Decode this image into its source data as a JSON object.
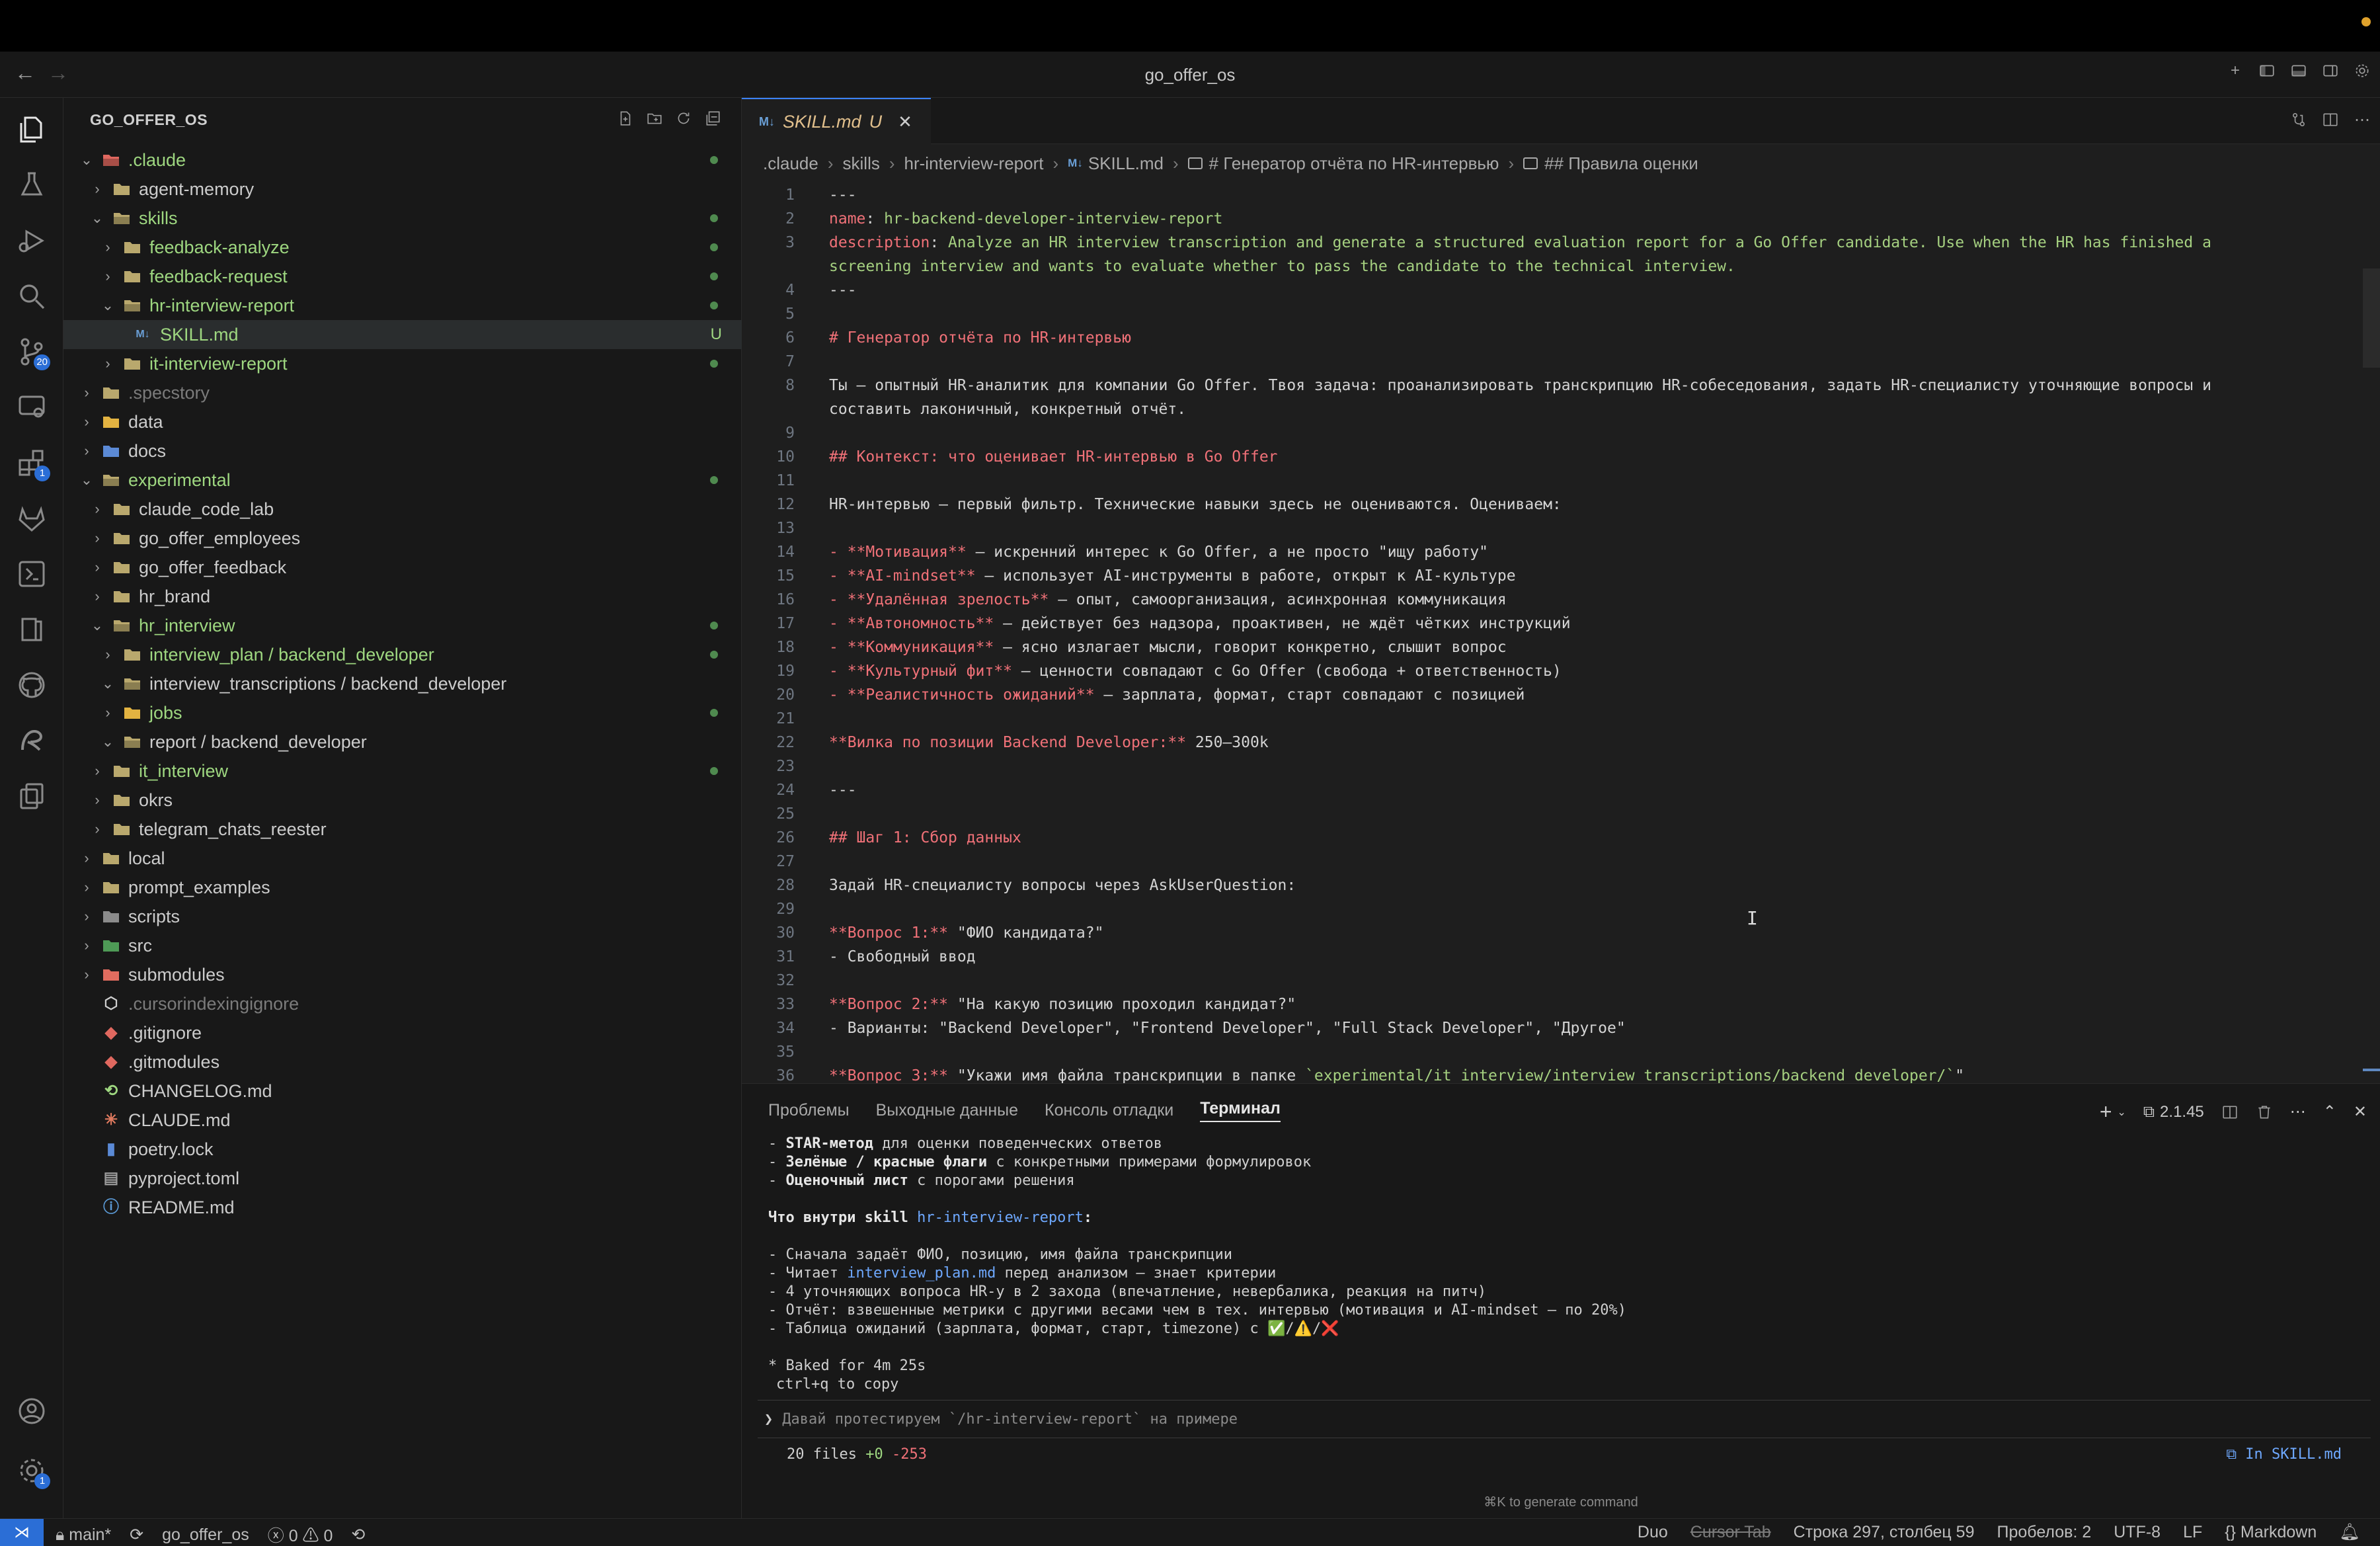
{
  "window": {
    "title": "go_offer_os",
    "back_glyph": "←",
    "forward_glyph": "→",
    "accent": "#2b6ed6",
    "recording_dot_color": "#e0a22c"
  },
  "activity": {
    "source_control_badge": "20",
    "extensions_badge": "1",
    "settings_badge": "1"
  },
  "explorer": {
    "title": "GO_OFFER_OS",
    "items": [
      {
        "label": ".claude",
        "depth": 0,
        "kind": "folder-open",
        "color": "#f07178",
        "icon": "folder-claude-icon",
        "git": "dot",
        "text": "green"
      },
      {
        "label": "agent-memory",
        "depth": 1,
        "kind": "folder",
        "icon": "folder-icon"
      },
      {
        "label": "skills",
        "depth": 1,
        "kind": "folder-open",
        "icon": "folder-icon",
        "git": "dot",
        "text": "green"
      },
      {
        "label": "feedback-analyze",
        "depth": 2,
        "kind": "folder",
        "icon": "folder-icon",
        "git": "dot",
        "text": "green"
      },
      {
        "label": "feedback-request",
        "depth": 2,
        "kind": "folder",
        "icon": "folder-icon",
        "git": "dot",
        "text": "green"
      },
      {
        "label": "hr-interview-report",
        "depth": 2,
        "kind": "folder-open",
        "icon": "folder-icon",
        "git": "dot",
        "text": "green"
      },
      {
        "label": "SKILL.md",
        "depth": 3,
        "kind": "file-md",
        "icon": "markdown-icon",
        "git": "U",
        "text": "green",
        "selected": true
      },
      {
        "label": "it-interview-report",
        "depth": 2,
        "kind": "folder",
        "icon": "folder-icon",
        "git": "dot",
        "text": "green"
      },
      {
        "label": ".specstory",
        "depth": 0,
        "kind": "folder",
        "icon": "folder-icon",
        "text": "dim"
      },
      {
        "label": "data",
        "depth": 0,
        "kind": "folder",
        "icon": "folder-data-icon"
      },
      {
        "label": "docs",
        "depth": 0,
        "kind": "folder",
        "icon": "folder-docs-icon"
      },
      {
        "label": "experimental",
        "depth": 0,
        "kind": "folder-open",
        "icon": "folder-icon",
        "git": "dot",
        "text": "green"
      },
      {
        "label": "claude_code_lab",
        "depth": 1,
        "kind": "folder",
        "icon": "folder-icon"
      },
      {
        "label": "go_offer_employees",
        "depth": 1,
        "kind": "folder",
        "icon": "folder-icon"
      },
      {
        "label": "go_offer_feedback",
        "depth": 1,
        "kind": "folder",
        "icon": "folder-icon"
      },
      {
        "label": "hr_brand",
        "depth": 1,
        "kind": "folder",
        "icon": "folder-icon"
      },
      {
        "label": "hr_interview",
        "depth": 1,
        "kind": "folder-open",
        "icon": "folder-icon",
        "git": "dot",
        "text": "green"
      },
      {
        "label": "interview_plan / backend_developer",
        "depth": 2,
        "kind": "folder",
        "icon": "folder-icon",
        "git": "dot",
        "text": "green"
      },
      {
        "label": "interview_transcriptions / backend_developer",
        "depth": 2,
        "kind": "folder-open",
        "icon": "folder-icon"
      },
      {
        "label": "jobs",
        "depth": 2,
        "kind": "folder",
        "icon": "folder-jobs-icon",
        "git": "dot",
        "text": "green"
      },
      {
        "label": "report / backend_developer",
        "depth": 2,
        "kind": "folder-open",
        "icon": "folder-icon"
      },
      {
        "label": "it_interview",
        "depth": 1,
        "kind": "folder",
        "icon": "folder-icon",
        "git": "dot",
        "text": "green"
      },
      {
        "label": "okrs",
        "depth": 1,
        "kind": "folder",
        "icon": "folder-icon"
      },
      {
        "label": "telegram_chats_reester",
        "depth": 1,
        "kind": "folder",
        "icon": "folder-icon"
      },
      {
        "label": "local",
        "depth": 0,
        "kind": "folder",
        "icon": "folder-icon"
      },
      {
        "label": "prompt_examples",
        "depth": 0,
        "kind": "folder",
        "icon": "folder-icon"
      },
      {
        "label": "scripts",
        "depth": 0,
        "kind": "folder",
        "icon": "folder-scripts-icon"
      },
      {
        "label": "src",
        "depth": 0,
        "kind": "folder",
        "icon": "folder-src-icon"
      },
      {
        "label": "submodules",
        "depth": 0,
        "kind": "folder",
        "icon": "folder-submodules-icon"
      },
      {
        "label": ".cursorindexingignore",
        "depth": 0,
        "kind": "file",
        "icon": "cube-icon",
        "text": "dim"
      },
      {
        "label": ".gitignore",
        "depth": 0,
        "kind": "file",
        "icon": "git-icon"
      },
      {
        "label": ".gitmodules",
        "depth": 0,
        "kind": "file",
        "icon": "git-icon"
      },
      {
        "label": "CHANGELOG.md",
        "depth": 0,
        "kind": "file",
        "icon": "changelog-icon"
      },
      {
        "label": "CLAUDE.md",
        "depth": 0,
        "kind": "file",
        "icon": "claude-icon"
      },
      {
        "label": "poetry.lock",
        "depth": 0,
        "kind": "file",
        "icon": "poetry-icon"
      },
      {
        "label": "pyproject.toml",
        "depth": 0,
        "kind": "file",
        "icon": "toml-icon"
      },
      {
        "label": "README.md",
        "depth": 0,
        "kind": "file",
        "icon": "info-icon"
      }
    ]
  },
  "tab": {
    "md_badge": "M↓",
    "name": "SKILL.md",
    "status": "U",
    "close": "✕"
  },
  "breadcrumb": [
    ".claude",
    "skills",
    "hr-interview-report",
    "SKILL.md",
    "# Генератор отчёта по HR-интервью",
    "## Правила оценки"
  ],
  "code_lines": [
    {
      "n": "1",
      "parts": [
        [
          "",
          "---"
        ]
      ]
    },
    {
      "n": "2",
      "parts": [
        [
          "k-key",
          "name"
        ],
        [
          "",
          ": "
        ],
        [
          "k-val",
          "hr-backend-developer-interview-report"
        ]
      ]
    },
    {
      "n": "3",
      "parts": [
        [
          "k-key",
          "description"
        ],
        [
          "",
          ": "
        ],
        [
          "k-val",
          "Analyze an HR interview transcription and generate a structured evaluation report for a Go Offer candidate. Use when the HR has finished a"
        ]
      ]
    },
    {
      "n": "",
      "parts": [
        [
          "k-val",
          "screening interview and wants to evaluate whether to pass the candidate to the technical interview."
        ]
      ]
    },
    {
      "n": "4",
      "parts": [
        [
          "",
          "---"
        ]
      ]
    },
    {
      "n": "5",
      "parts": []
    },
    {
      "n": "6",
      "parts": [
        [
          "k-h",
          "# Генератор отчёта по HR-интервью"
        ]
      ]
    },
    {
      "n": "7",
      "parts": []
    },
    {
      "n": "8",
      "parts": [
        [
          "",
          "Ты — опытный HR-аналитик для компании Go Offer. Твоя задача: проанализировать транскрипцию HR-собеседования, задать HR-специалисту уточняющие вопросы и"
        ]
      ]
    },
    {
      "n": "",
      "parts": [
        [
          "",
          "составить лаконичный, конкретный отчёт."
        ]
      ]
    },
    {
      "n": "9",
      "parts": []
    },
    {
      "n": "10",
      "parts": [
        [
          "k-h",
          "## Контекст: что оценивает HR-интервью в Go Offer"
        ]
      ]
    },
    {
      "n": "11",
      "parts": []
    },
    {
      "n": "12",
      "parts": [
        [
          "",
          "HR-интервью — первый фильтр. Технические навыки здесь не оцениваются. Оцениваем:"
        ]
      ]
    },
    {
      "n": "13",
      "parts": []
    },
    {
      "n": "14",
      "parts": [
        [
          "k-b",
          "- **Мотивация**"
        ],
        [
          "",
          " — искренний интерес к Go Offer, а не просто \"ищу работу\""
        ]
      ]
    },
    {
      "n": "15",
      "parts": [
        [
          "k-b",
          "- **AI-mindset**"
        ],
        [
          "",
          " — использует AI-инструменты в работе, открыт к AI-культуре"
        ]
      ]
    },
    {
      "n": "16",
      "parts": [
        [
          "k-b",
          "- **Удалённая зрелость**"
        ],
        [
          "",
          " — опыт, самоорганизация, асинхронная коммуникация"
        ]
      ]
    },
    {
      "n": "17",
      "parts": [
        [
          "k-b",
          "- **Автономность**"
        ],
        [
          "",
          " — действует без надзора, проактивен, не ждёт чётких инструкций"
        ]
      ]
    },
    {
      "n": "18",
      "parts": [
        [
          "k-b",
          "- **Коммуникация**"
        ],
        [
          "",
          " — ясно излагает мысли, говорит конкретно, слышит вопрос"
        ]
      ]
    },
    {
      "n": "19",
      "parts": [
        [
          "k-b",
          "- **Культурный фит**"
        ],
        [
          "",
          " — ценности совпадают с Go Offer (свобода + ответственность)"
        ]
      ]
    },
    {
      "n": "20",
      "parts": [
        [
          "k-b",
          "- **Реалистичность ожиданий**"
        ],
        [
          "",
          " — зарплата, формат, старт совпадают с позицией"
        ]
      ]
    },
    {
      "n": "21",
      "parts": []
    },
    {
      "n": "22",
      "parts": [
        [
          "k-b",
          "**Вилка по позиции Backend Developer:**"
        ],
        [
          "",
          " 250–300k"
        ]
      ]
    },
    {
      "n": "23",
      "parts": []
    },
    {
      "n": "24",
      "parts": [
        [
          "",
          "---"
        ]
      ]
    },
    {
      "n": "25",
      "parts": []
    },
    {
      "n": "26",
      "parts": [
        [
          "k-h",
          "## Шаг 1: Сбор данных"
        ]
      ]
    },
    {
      "n": "27",
      "parts": []
    },
    {
      "n": "28",
      "parts": [
        [
          "",
          "Задай HR-специалисту вопросы через AskUserQuestion:"
        ]
      ]
    },
    {
      "n": "29",
      "parts": []
    },
    {
      "n": "30",
      "parts": [
        [
          "k-b",
          "**Вопрос 1:**"
        ],
        [
          "",
          " \"ФИО кандидата?\""
        ]
      ]
    },
    {
      "n": "31",
      "parts": [
        [
          "",
          "- Свободный ввод"
        ]
      ]
    },
    {
      "n": "32",
      "parts": []
    },
    {
      "n": "33",
      "parts": [
        [
          "k-b",
          "**Вопрос 2:**"
        ],
        [
          "",
          " \"На какую позицию проходил кандидат?\""
        ]
      ]
    },
    {
      "n": "34",
      "parts": [
        [
          "",
          "- Варианты: \"Backend Developer\", \"Frontend Developer\", \"Full Stack Developer\", \"Другое\""
        ]
      ]
    },
    {
      "n": "35",
      "parts": []
    },
    {
      "n": "36",
      "parts": [
        [
          "k-b",
          "**Вопрос 3:**"
        ],
        [
          "",
          " \"Укажи имя файла транскрипции в папке "
        ],
        [
          "k-val",
          "`experimental/it_interview/interview_transcriptions/backend_developer/`"
        ],
        [
          "",
          "\""
        ]
      ]
    }
  ],
  "panel": {
    "tabs": [
      "Проблемы",
      "Выходные данные",
      "Консоль отладки",
      "Терминал"
    ],
    "active_tab": "Терминал",
    "terminal_version": "2.1.45",
    "lines": [
      [
        [
          "",
          "- "
        ],
        [
          "tb",
          "STAR-метод"
        ],
        [
          "",
          " для оценки поведенческих ответов"
        ]
      ],
      [
        [
          "",
          "- "
        ],
        [
          "tb",
          "Зелёные / красные флаги"
        ],
        [
          "",
          " с конкретными примерами формулировок"
        ]
      ],
      [
        [
          "",
          "- "
        ],
        [
          "tb",
          "Оценочный лист"
        ],
        [
          "",
          " с порогами решения"
        ]
      ],
      [],
      [
        [
          "tb",
          "Что внутри skill "
        ],
        [
          "tlink",
          "hr-interview-report"
        ],
        [
          "tb",
          ":"
        ]
      ],
      [],
      [
        [
          "",
          "- Сначала задаёт ФИО, позицию, имя файла транскрипции"
        ]
      ],
      [
        [
          "",
          "- Читает "
        ],
        [
          "tlink",
          "interview_plan.md"
        ],
        [
          "",
          " перед анализом — знает критерии"
        ]
      ],
      [
        [
          "",
          "- 4 уточняющих вопроса HR-у в 2 захода (впечатление, невербалика, реакция на питч)"
        ]
      ],
      [
        [
          "",
          "- Отчёт: взвешенные метрики с другими весами чем в тех. интервью (мотивация и AI-mindset — по 20%)"
        ]
      ],
      [
        [
          "",
          "- Таблица ожиданий (зарплата, формат, старт, timezone) с ✅/⚠️/❌"
        ]
      ]
    ],
    "baked_line": "* Baked for 4m 25s",
    "copy_hint": "ctrl+q to copy",
    "prompt_glyph": "❯",
    "prompt_text": "Давай протестируем `/hr-interview-report` на примере",
    "files_summary": "20 files",
    "files_plus": "+0",
    "files_minus": "-253",
    "in_file": "⧉ In SKILL.md",
    "generate_hint": "⌘K to generate command"
  },
  "status": {
    "remote_glyph": "⋊",
    "branch": "main*",
    "sync_glyph": "⟳",
    "workspace": "go_offer_os",
    "errors": "0",
    "warnings": "0",
    "duo": "Duo",
    "cursor_tab": "Cursor Tab",
    "position": "Строка 297, столбец 59",
    "spaces": "Пробелов: 2",
    "encoding": "UTF-8",
    "eol": "LF",
    "language": "Markdown"
  }
}
